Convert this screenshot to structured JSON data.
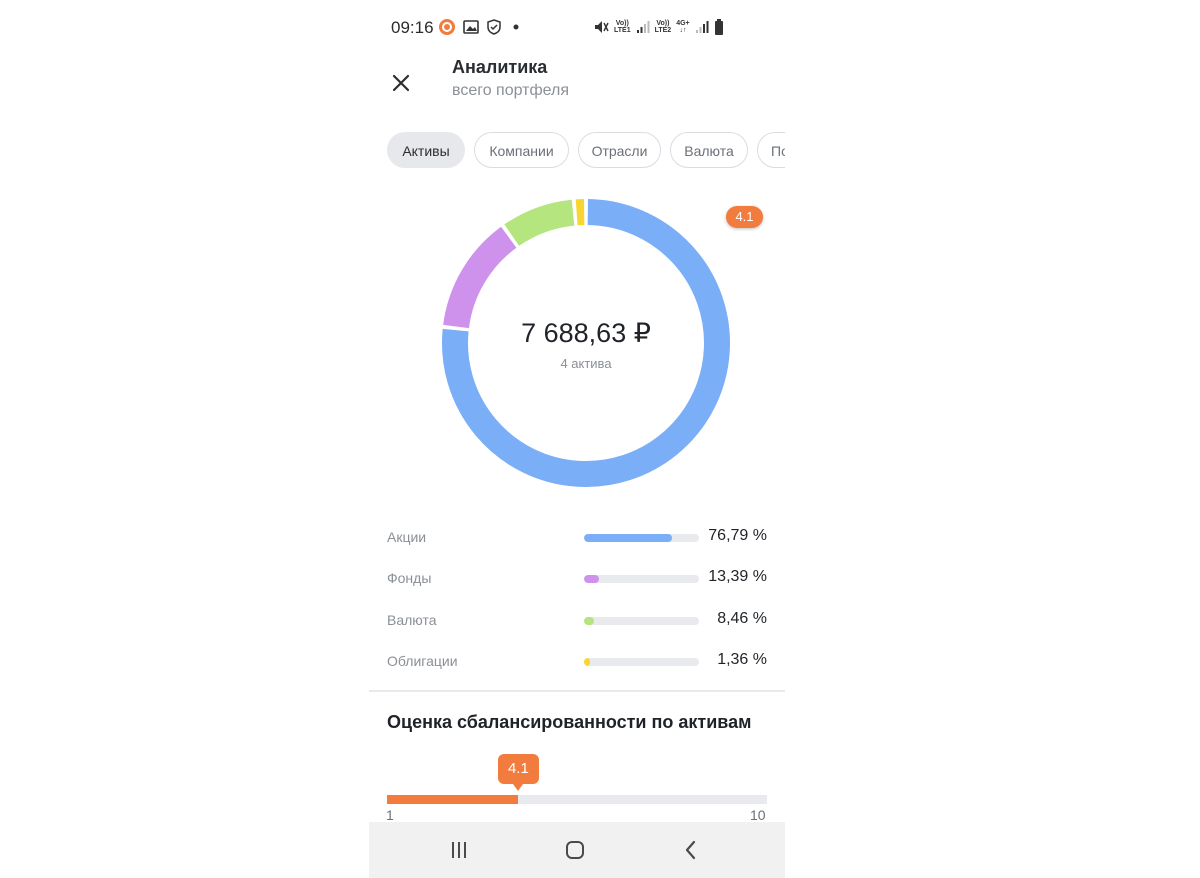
{
  "status_bar": {
    "time": "09:16",
    "icons": [
      "app-notification-icon",
      "gallery-icon",
      "shield-icon",
      "dot-icon",
      "mute-icon",
      "volte-lte1-icon",
      "signal-icon",
      "volte-lte2-icon",
      "4g-icon",
      "signal-icon",
      "battery-icon"
    ],
    "volte1_top": "Vo))",
    "volte1_bottom": "LTE1",
    "volte2_top": "Vo))",
    "volte2_bottom": "LTE2",
    "net_type": "4G+"
  },
  "header": {
    "title": "Аналитика",
    "subtitle": "всего портфеля",
    "close_icon": "close-icon"
  },
  "tabs": [
    {
      "label": "Активы",
      "active": true
    },
    {
      "label": "Компании",
      "active": false
    },
    {
      "label": "Отрасли",
      "active": false
    },
    {
      "label": "Валюта",
      "active": false
    },
    {
      "label": "По",
      "active": false
    }
  ],
  "donut": {
    "total": "7 688,63 ₽",
    "subtitle": "4 актива",
    "score_badge": "4.1"
  },
  "breakdown": [
    {
      "label": "Акции",
      "value": "76,79 %",
      "share": 76.79,
      "color": "#7aaef7"
    },
    {
      "label": "Фонды",
      "value": "13,39 %",
      "share": 13.39,
      "color": "#cf92ec"
    },
    {
      "label": "Валюта",
      "value": "8,46 %",
      "share": 8.46,
      "color": "#b5e57e"
    },
    {
      "label": "Облигации",
      "value": "1,36 %",
      "share": 1.36,
      "color": "#f8d62e"
    }
  ],
  "balance": {
    "title": "Оценка сбалансированности по активам",
    "score": "4.1",
    "score_value": 4.1,
    "min": "1",
    "max": "10",
    "min_value": 1,
    "max_value": 10,
    "accent": "#f27c3e"
  },
  "nav": {
    "icons": [
      "recent-apps-icon",
      "home-icon",
      "back-icon"
    ]
  }
}
